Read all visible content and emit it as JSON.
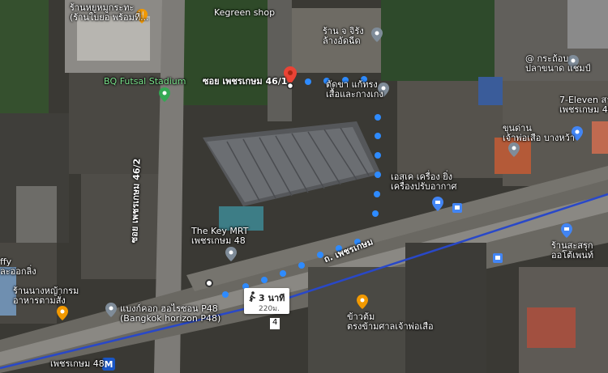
{
  "map": {
    "places": [
      {
        "id": "restaurant-top",
        "name": "ร้านหยูหมูกระทะ\n(ร้านใบยอ พร้อมที่...",
        "kind": "food"
      },
      {
        "id": "kegreen",
        "name": "Kegreen shop",
        "kind": "shop"
      },
      {
        "id": "futsal",
        "name": "BQ Futsal Stadium",
        "kind": "park"
      },
      {
        "id": "laundry",
        "name": "ร้าน จ จิรัง\nล้างอัดฉีด",
        "kind": "shop"
      },
      {
        "id": "krathong",
        "name": "@ กระถ้อบ\nปลาขนาด แชมป์",
        "kind": "shop"
      },
      {
        "id": "tailor",
        "name": "ตัดขา แก้ทรง\nเสื้อและกางเกง",
        "kind": "shop"
      },
      {
        "id": "seven",
        "name": "7-Eleven สาขา\nเพชรเกษม 46",
        "kind": "shop"
      },
      {
        "id": "shrine",
        "name": "ขุนด่าน\nเจ้าพ่อเสือ บางหว้า",
        "kind": "landmark"
      },
      {
        "id": "sk-air",
        "name": "เอสเค เครื่อง ยิ่ง\nเครื่องปรับอากาศ",
        "kind": "shop"
      },
      {
        "id": "thekey",
        "name": "The Key MRT\nเพชรเกษม 48",
        "kind": "building"
      },
      {
        "id": "sport",
        "name": "ร้านสะสรุก\nออโต้เพนท์",
        "kind": "shop"
      },
      {
        "id": "halal",
        "name": "ร้านนางหญ้ากรม\nอาหารตามสั่ง",
        "kind": "food"
      },
      {
        "id": "horizon",
        "name": "แบงก์คอก ฮอไรซอน P48\n(Bangkok horizon P48)",
        "kind": "building"
      },
      {
        "id": "khao",
        "name": "ข้าวต้ม\nตรงข้ามศาลเจ้าพ่อเสือ",
        "kind": "food"
      },
      {
        "id": "mrt",
        "name": "เพชรเกษม 48",
        "kind": "station"
      },
      {
        "id": "ffy",
        "name": "ffy\nละออกลิ่ง",
        "kind": "shop"
      }
    ],
    "roads": {
      "soi_vertical": "ซอย เพชรเกษม 46/2",
      "main": "ถ. เพชรเกษม"
    },
    "destination": {
      "name": "ซอย เพชรเกษม 46/1"
    },
    "route_info": {
      "time": "3 นาที",
      "distance": "220ม."
    },
    "marker_number": "4"
  }
}
